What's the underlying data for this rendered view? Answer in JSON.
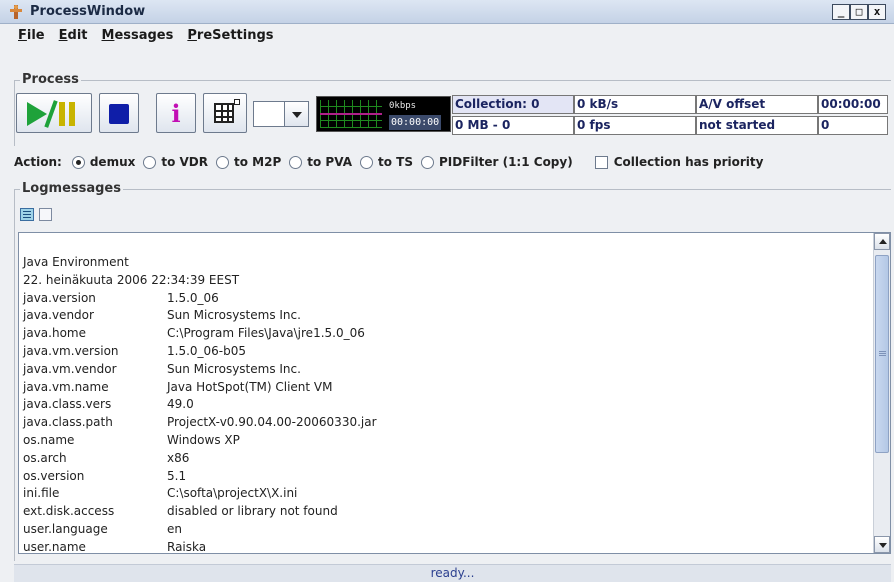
{
  "window": {
    "title": "ProcessWindow",
    "min_label": "_",
    "max_label": "□",
    "close_label": "x"
  },
  "menu": [
    {
      "label": "File",
      "mnemonic": "F",
      "rest": "ile"
    },
    {
      "label": "Edit",
      "mnemonic": "E",
      "rest": "dit"
    },
    {
      "label": "Messages",
      "mnemonic": "M",
      "rest": "essages"
    },
    {
      "label": "PreSettings",
      "mnemonic": "P",
      "rest": "reSettings"
    }
  ],
  "process": {
    "group_title": "Process",
    "info_label": "i",
    "monitor": {
      "rate": "0kbps",
      "time": "00:00:00"
    },
    "cells": {
      "collection": "Collection: 0",
      "kbps": "0 kB/s",
      "av_offset_label": "A/V offset",
      "av_time": "00:00:00",
      "mb": "0 MB - 0",
      "fps": "0 fps",
      "state": "not started",
      "count": "0"
    }
  },
  "action": {
    "label": "Action:",
    "options": [
      "demux",
      "to VDR",
      "to M2P",
      "to PVA",
      "to TS",
      "PIDFilter (1:1 Copy)"
    ],
    "selected": "demux",
    "priority_label": "Collection has priority",
    "priority_checked": false
  },
  "log": {
    "group_title": "Logmessages",
    "header": "Java Environment",
    "date": "22. heinäkuuta 2006   22:34:39 EEST",
    "entries": [
      {
        "key": "java.version",
        "value": "1.5.0_06"
      },
      {
        "key": "java.vendor",
        "value": "Sun Microsystems Inc."
      },
      {
        "key": "java.home",
        "value": "C:\\Program Files\\Java\\jre1.5.0_06"
      },
      {
        "key": "java.vm.version",
        "value": "1.5.0_06-b05"
      },
      {
        "key": "java.vm.vendor",
        "value": "Sun Microsystems Inc."
      },
      {
        "key": "java.vm.name",
        "value": "Java HotSpot(TM) Client VM"
      },
      {
        "key": "java.class.vers",
        "value": "49.0"
      },
      {
        "key": "java.class.path",
        "value": "ProjectX-v0.90.04.00-20060330.jar"
      },
      {
        "key": "os.name",
        "value": "Windows XP"
      },
      {
        "key": "os.arch",
        "value": "x86"
      },
      {
        "key": "os.version",
        "value": "5.1"
      },
      {
        "key": "ini.file",
        "value": "C:\\softa\\projectX\\X.ini"
      },
      {
        "key": "ext.disk.access",
        "value": "disabled or library not found"
      },
      {
        "key": "user.language",
        "value": "en"
      },
      {
        "key": "user.name",
        "value": "Raiska"
      }
    ]
  },
  "status": "ready...",
  "colors": {
    "play": "#1ea23a",
    "pause": "#c8b400",
    "stop": "#0f1ea8",
    "info": "#c20fb4",
    "status_text": "#2b3f8f"
  }
}
